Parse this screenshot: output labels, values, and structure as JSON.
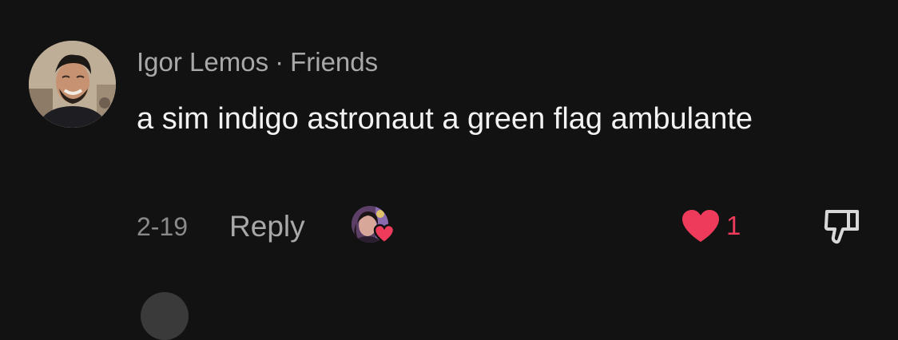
{
  "comment": {
    "author": "Igor Lemos",
    "separator": "·",
    "relation": "Friends",
    "text": "a sim indigo astronaut a green flag ambulante",
    "date": "2-19",
    "reply_label": "Reply",
    "like_count": "1",
    "liked": true,
    "icons": {
      "like": "heart-icon",
      "dislike": "thumbs-down-icon",
      "reactor_badge": "heart-icon"
    }
  },
  "colors": {
    "background": "#121212",
    "heart": "#ee3b5b",
    "muted_text": "#a8a8a8"
  }
}
